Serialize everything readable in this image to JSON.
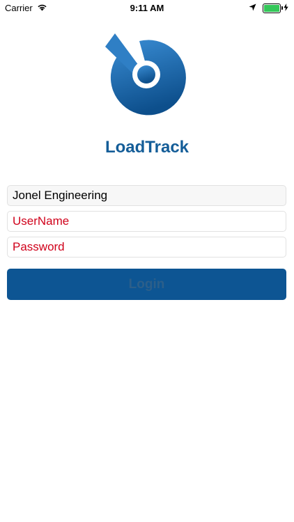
{
  "status_bar": {
    "carrier": "Carrier",
    "time": "9:11 AM",
    "battery_level": 1.0,
    "battery_color": "#34c759"
  },
  "logo": {
    "icon": "satellite-dish-logo-icon",
    "colors": [
      "#3a8dd4",
      "#0d4f8c"
    ]
  },
  "app": {
    "title": "LoadTrack",
    "title_color": "#145d98"
  },
  "form": {
    "company_value": "Jonel Engineering",
    "username_placeholder": "UserName",
    "password_placeholder": "Password",
    "placeholder_color": "#d0021b"
  },
  "login": {
    "label": "Login",
    "background": "#0d5593"
  }
}
